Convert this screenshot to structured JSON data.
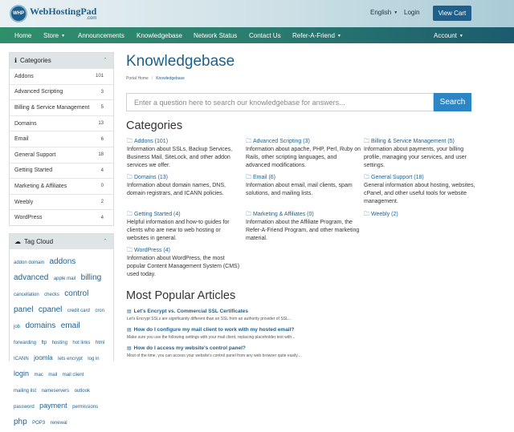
{
  "header": {
    "logo_badge": "WHP",
    "logo_text": "WebHostingPad",
    "logo_sub": ".com",
    "language": "English",
    "login": "Login",
    "view_cart": "View Cart"
  },
  "nav": {
    "items": [
      {
        "label": "Home"
      },
      {
        "label": "Store"
      },
      {
        "label": "Announcements"
      },
      {
        "label": "Knowledgebase"
      },
      {
        "label": "Network Status"
      },
      {
        "label": "Contact Us"
      },
      {
        "label": "Refer-A-Friend"
      }
    ],
    "account": "Account"
  },
  "sidebar": {
    "categories_title": "Categories",
    "categories": [
      {
        "label": "Addons",
        "count": "101"
      },
      {
        "label": "Advanced Scripting",
        "count": "3"
      },
      {
        "label": "Billing & Service Management",
        "count": "5"
      },
      {
        "label": "Domains",
        "count": "13"
      },
      {
        "label": "Email",
        "count": "6"
      },
      {
        "label": "General Support",
        "count": "18"
      },
      {
        "label": "Getting Started",
        "count": "4"
      },
      {
        "label": "Marketing & Affiliates",
        "count": "0"
      },
      {
        "label": "Weebly",
        "count": "2"
      },
      {
        "label": "WordPress",
        "count": "4"
      }
    ],
    "tagcloud_title": "Tag Cloud",
    "tags": [
      {
        "t": "addon domain",
        "s": 6
      },
      {
        "t": "addons",
        "s": 10
      },
      {
        "t": "advanced",
        "s": 10
      },
      {
        "t": "apple mail",
        "s": 6
      },
      {
        "t": "billing",
        "s": 10
      },
      {
        "t": "cancellation",
        "s": 6
      },
      {
        "t": "checks",
        "s": 6
      },
      {
        "t": "control",
        "s": 10
      },
      {
        "t": "panel",
        "s": 10
      },
      {
        "t": "cpanel",
        "s": 10
      },
      {
        "t": "credit card",
        "s": 6
      },
      {
        "t": "cron",
        "s": 6
      },
      {
        "t": "job",
        "s": 6
      },
      {
        "t": "domains",
        "s": 10
      },
      {
        "t": "email",
        "s": 10
      },
      {
        "t": "forwarding",
        "s": 6
      },
      {
        "t": "ftp",
        "s": 6
      },
      {
        "t": "hosting",
        "s": 6
      },
      {
        "t": "hot links",
        "s": 6
      },
      {
        "t": "html",
        "s": 6
      },
      {
        "t": "ICANN",
        "s": 6
      },
      {
        "t": "joomla",
        "s": 8
      },
      {
        "t": "lets encrypt",
        "s": 6
      },
      {
        "t": "log in",
        "s": 6
      },
      {
        "t": "login",
        "s": 9
      },
      {
        "t": "mac",
        "s": 6
      },
      {
        "t": "mail",
        "s": 6
      },
      {
        "t": "mail client",
        "s": 6
      },
      {
        "t": "mailing list",
        "s": 6
      },
      {
        "t": "nameservers",
        "s": 6
      },
      {
        "t": "outlook",
        "s": 6
      },
      {
        "t": "password",
        "s": 6
      },
      {
        "t": "payment",
        "s": 9
      },
      {
        "t": "permissions",
        "s": 6
      },
      {
        "t": "php",
        "s": 10
      },
      {
        "t": "POP3",
        "s": 6
      },
      {
        "t": "renewal",
        "s": 6
      }
    ]
  },
  "main": {
    "title": "Knowledgebase",
    "breadcrumb": [
      "Portal Home",
      "Knowledgebase"
    ],
    "search_placeholder": "Enter a question here to search our knowledgebase for answers...",
    "search_button": "Search",
    "categories_heading": "Categories",
    "categories": [
      {
        "label": "Addons (101)",
        "desc": "Information about SSLs, Backup Services, Business Mail, SiteLock, and other addon services we offer."
      },
      {
        "label": "Advanced Scripting (3)",
        "desc": "Information about apache, PHP, Perl, Ruby on Rails, other scripting languages, and advanced modifications."
      },
      {
        "label": "Billing & Service Management (5)",
        "desc": "Information about payments, your billing profile, managing your services, and user settings."
      },
      {
        "label": "Domains (13)",
        "desc": "Information about domain names, DNS, domain registrars, and ICANN policies."
      },
      {
        "label": "Email (6)",
        "desc": "Information about email, mail clients, spam solutions, and mailing lists."
      },
      {
        "label": "General Support (18)",
        "desc": "General information about hosting, websites, cPanel, and other useful tools for website management."
      },
      {
        "label": "Getting Started (4)",
        "desc": "Helpful information and how-to guides for clients who are new to web hosting or websites in general."
      },
      {
        "label": "Marketing & Affiliates (0)",
        "desc": "Information about the Affiliate Program, the Refer-A-Friend Program, and other marketing material."
      },
      {
        "label": "Weebly (2)",
        "desc": ""
      },
      {
        "label": "WordPress (4)",
        "desc": "Information about WordPress, the most popular Content Management System (CMS) used today."
      }
    ],
    "popular_heading": "Most Popular Articles",
    "articles": [
      {
        "title": "Let's Encrypt vs. Commercial SSL Certificates",
        "desc": "Let's Encrypt SSLs are significantly different than an SSL from an authority provider of SSL..."
      },
      {
        "title": "How do I configure my mail client to work with my hosted email?",
        "desc": "Make sure you use the following settings with your mail client, replacing placeholder text with..."
      },
      {
        "title": "How do I access my website's control panel?",
        "desc": "Most of the time, you can access your website's control panel from any web browser quite easily...."
      }
    ]
  }
}
